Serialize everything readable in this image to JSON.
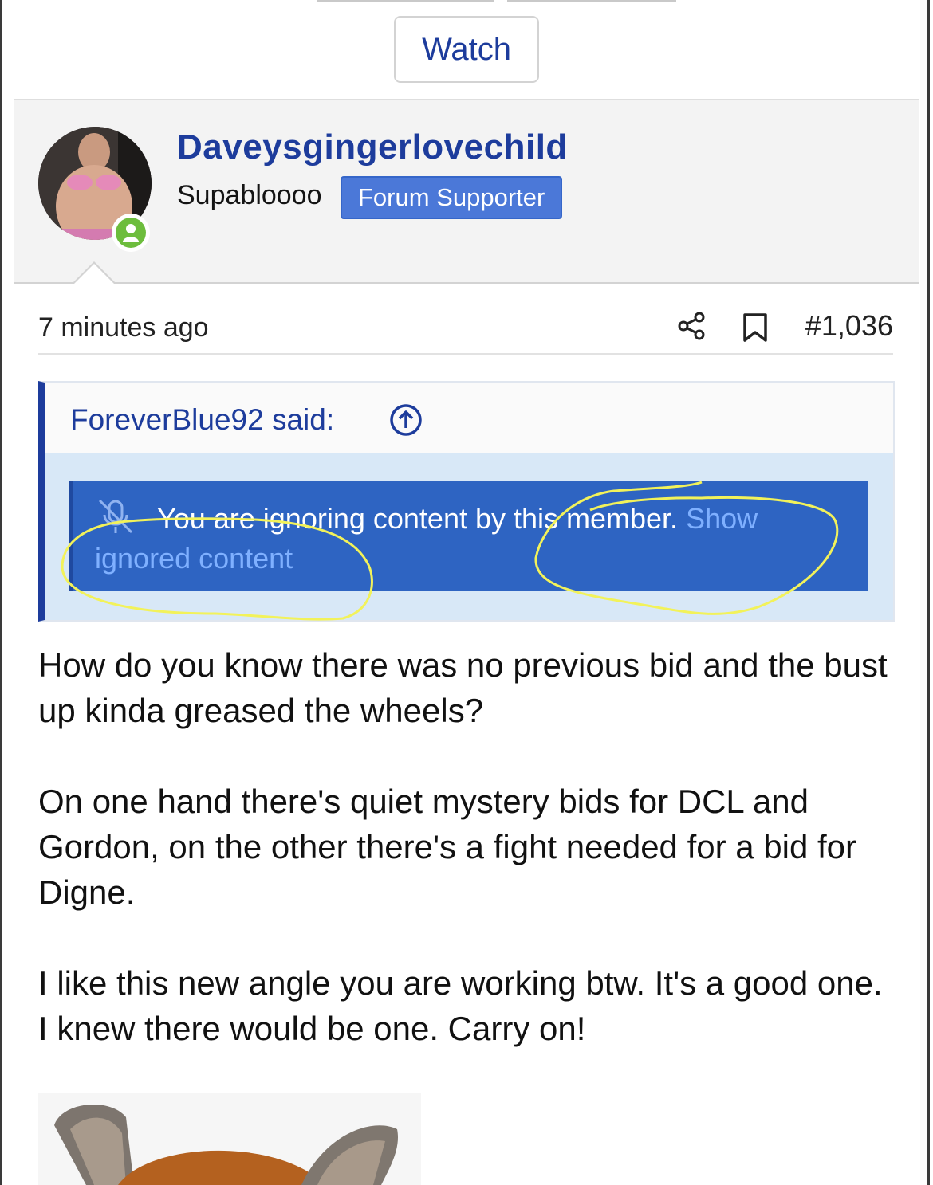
{
  "toolbar": {
    "watch_label": "Watch"
  },
  "post": {
    "author": {
      "username": "Daveysgingerlovechild",
      "user_title": "Supabloooo",
      "badge": "Forum Supporter",
      "online_status_icon": "user-online-icon"
    },
    "timestamp": "7 minutes ago",
    "actions": {
      "share_icon": "share-icon",
      "bookmark_icon": "bookmark-icon"
    },
    "post_number": "#1,036",
    "quote": {
      "author_said": "ForeverBlue92 said:",
      "jump_icon": "arrow-up-circle-icon",
      "ignored_notice": "You are ignoring content by this member.",
      "show_link": "Show ignored content",
      "ignored_icon": "muted-microphone-icon"
    },
    "body": [
      "How do you know there was no previous bid and the bust up kinda greased the wheels?",
      "On one hand there's quiet mystery bids for DCL and Gordon, on the other there's a fight needed for a bid for Digne.",
      "I like this new angle you are working btw. It's a good one. I knew there would be one. Carry on!"
    ]
  },
  "colors": {
    "link_blue": "#1d3c9c",
    "badge_blue": "#4b78d8",
    "ignored_box_blue": "#2e64c2",
    "quote_body_bg": "#d8e8f7",
    "online_green": "#6dbd3d",
    "annotation_yellow": "#f2f25a"
  }
}
